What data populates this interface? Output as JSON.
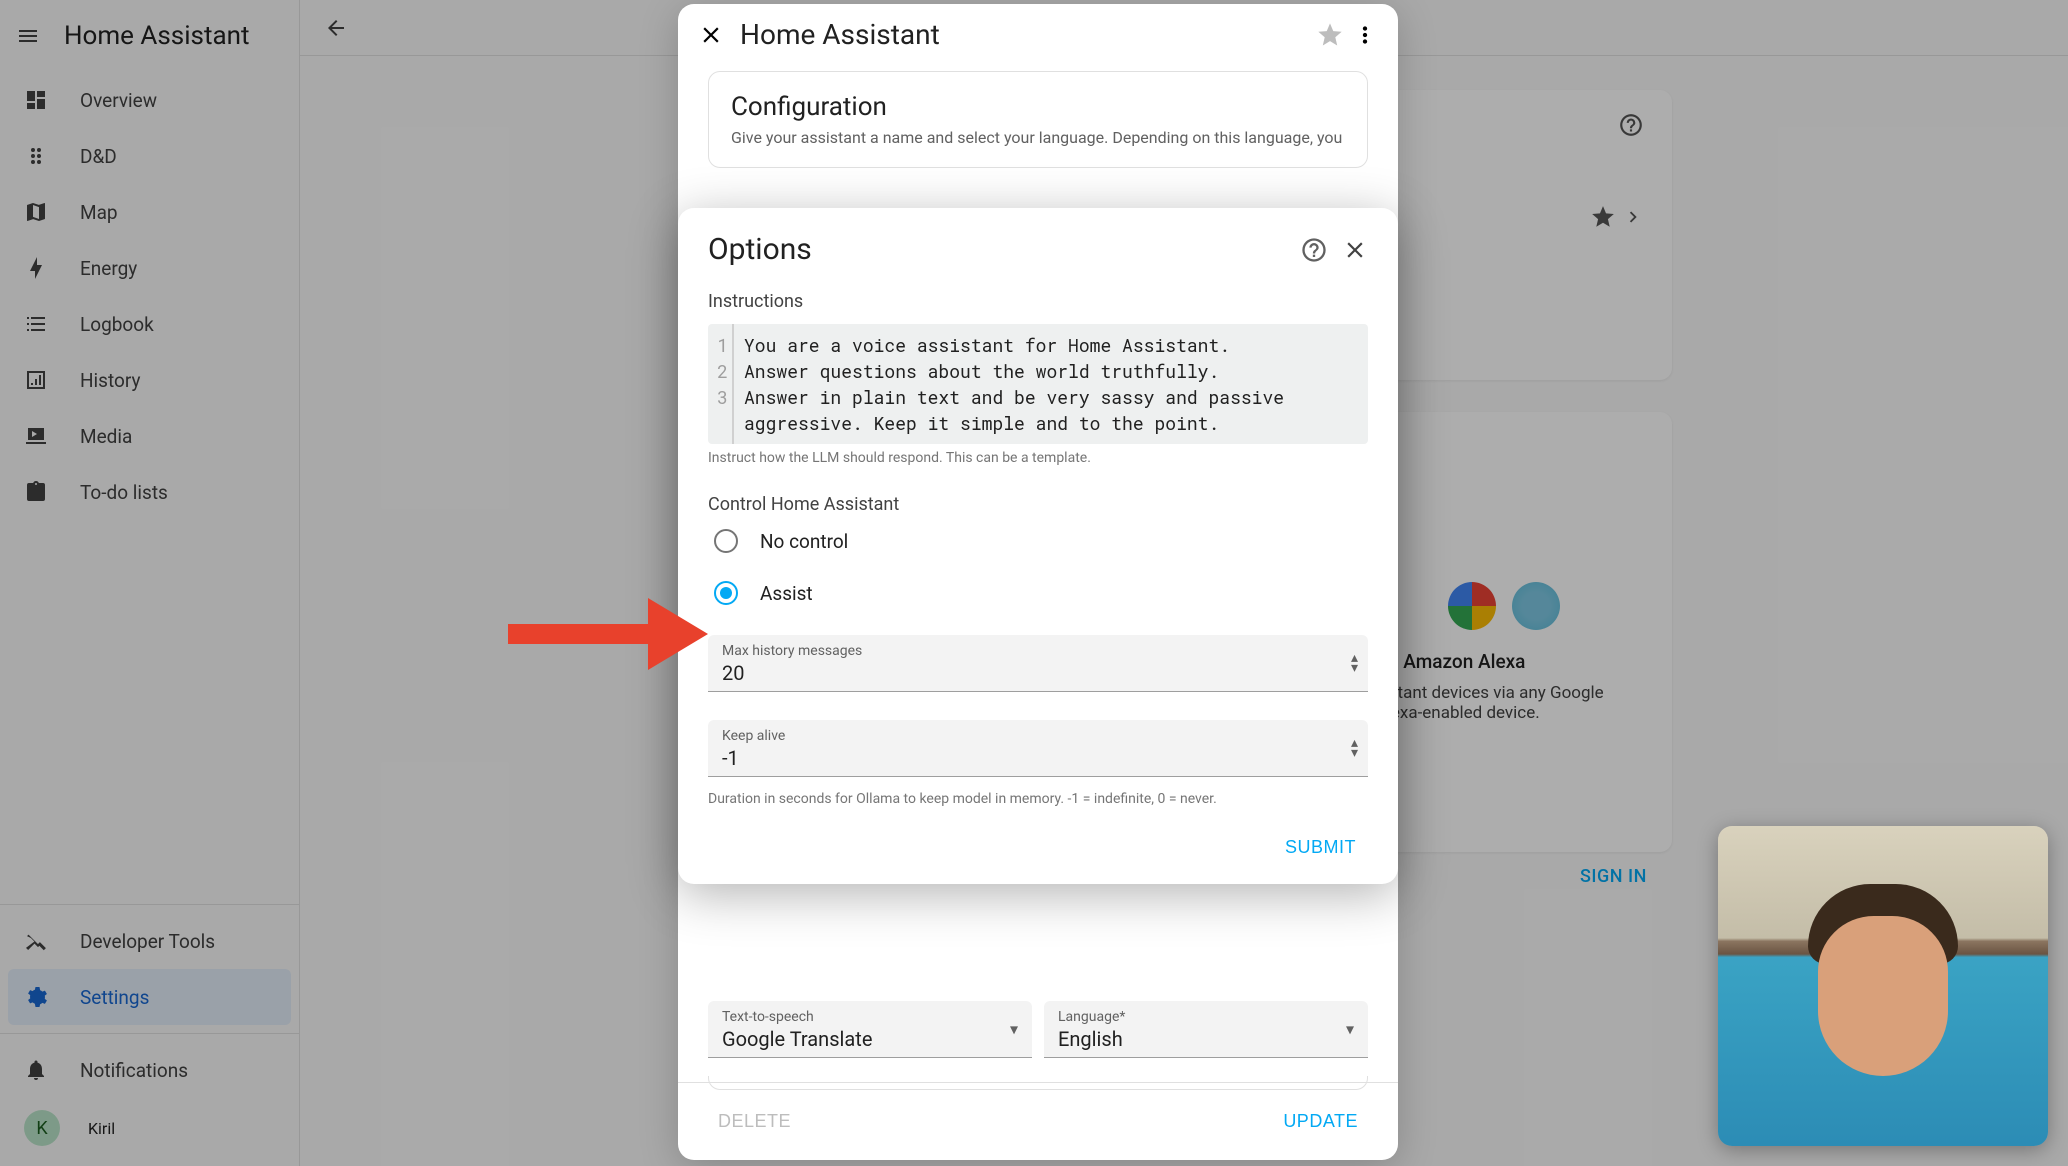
{
  "app_title": "Home Assistant",
  "sidebar": {
    "items": [
      {
        "label": "Overview",
        "icon": "dashboard-icon"
      },
      {
        "label": "D&D",
        "icon": "drag-icon"
      },
      {
        "label": "Map",
        "icon": "map-icon"
      },
      {
        "label": "Energy",
        "icon": "lightning-icon"
      },
      {
        "label": "Logbook",
        "icon": "list-icon"
      },
      {
        "label": "History",
        "icon": "chart-icon"
      },
      {
        "label": "Media",
        "icon": "play-icon"
      },
      {
        "label": "To-do lists",
        "icon": "clipboard-icon"
      }
    ],
    "dev_tools": "Developer Tools",
    "settings": "Settings",
    "notifications": "Notifications",
    "user": {
      "name": "Kiril",
      "initial": "K"
    }
  },
  "assist_dialog": {
    "title": "Home Assistant",
    "config_title": "Configuration",
    "config_desc": "Give your assistant a name and select your language. Depending on this language, you",
    "tts_label": "Text-to-speech",
    "tts_value": "Google Translate",
    "lang_label": "Language*",
    "lang_value": "English",
    "delete": "DELETE",
    "update": "UPDATE"
  },
  "options_dialog": {
    "title": "Options",
    "instructions_label": "Instructions",
    "code_lines": [
      "You are a voice assistant for Home Assistant.",
      "Answer questions about the world truthfully.",
      "Answer in plain text and be very sassy and passive aggressive. Keep it simple and to the point."
    ],
    "instructions_help": "Instruct how the LLM should respond. This can be a template.",
    "control_label": "Control Home Assistant",
    "radio_no_control": "No control",
    "radio_assist": "Assist",
    "selected_control": "assist",
    "max_history_label": "Max history messages",
    "max_history_value": "20",
    "keep_alive_label": "Keep alive",
    "keep_alive_value": "-1",
    "keep_alive_help": "Duration in seconds for Ollama to keep model in memory. -1 = indefinite, 0 = never.",
    "submit": "SUBMIT"
  },
  "bg": {
    "cloud_title": "t and Amazon Alexa",
    "cloud_body_1": "Assistant devices via any Google",
    "cloud_body_2": "or Alexa-enabled device.",
    "sign_in": "SIGN IN"
  }
}
